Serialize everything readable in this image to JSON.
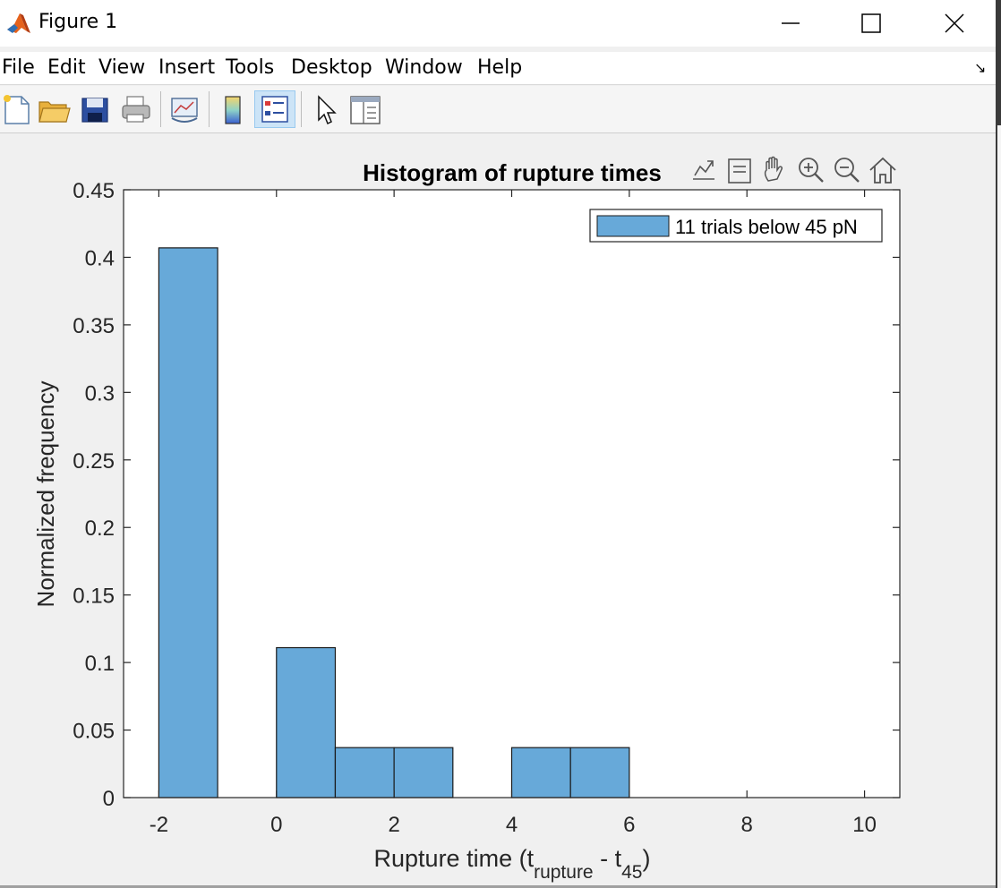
{
  "window": {
    "title": "Figure 1",
    "controls": [
      "minimize",
      "maximize",
      "close"
    ]
  },
  "menu": {
    "items": [
      {
        "label": "File"
      },
      {
        "label": "Edit"
      },
      {
        "label": "View"
      },
      {
        "label": "Insert"
      },
      {
        "label": "Tools"
      },
      {
        "label": "Desktop"
      },
      {
        "label": "Window"
      },
      {
        "label": "Help"
      }
    ]
  },
  "toolbar": {
    "buttons": [
      "new-figure-icon",
      "open-file-icon",
      "save-icon",
      "print-icon",
      "link-plot-icon",
      "colorbar-icon",
      "legend-icon",
      "pointer-icon",
      "property-editor-icon"
    ],
    "pressed": "legend-icon"
  },
  "axes_toolbar": {
    "buttons": [
      "export-icon",
      "brush-icon",
      "pan-icon",
      "zoom-in-icon",
      "zoom-out-icon",
      "home-icon"
    ]
  },
  "colors": {
    "bar_fill": "#67a9d9",
    "bar_edge": "#1a1a1a",
    "axis": "#262626",
    "background": "#ffffff"
  },
  "chart_data": {
    "type": "bar",
    "title": "Histogram of rupture times",
    "xlabel_main": "Rupture time (t",
    "xlabel_sub1": "rupture",
    "xlabel_mid": " - t",
    "xlabel_sub2": "45",
    "xlabel_end": ")",
    "ylabel": "Normalized frequency",
    "xlim": [
      -2.6,
      10.6
    ],
    "ylim": [
      0,
      0.45
    ],
    "xticks": [
      {
        "v": -2,
        "label": "-2"
      },
      {
        "v": 0,
        "label": "0"
      },
      {
        "v": 2,
        "label": "2"
      },
      {
        "v": 4,
        "label": "4"
      },
      {
        "v": 6,
        "label": "6"
      },
      {
        "v": 8,
        "label": "8"
      },
      {
        "v": 10,
        "label": "10"
      }
    ],
    "yticks": [
      {
        "v": 0,
        "label": "0"
      },
      {
        "v": 0.05,
        "label": "0.05"
      },
      {
        "v": 0.1,
        "label": "0.1"
      },
      {
        "v": 0.15,
        "label": "0.15"
      },
      {
        "v": 0.2,
        "label": "0.2"
      },
      {
        "v": 0.25,
        "label": "0.25"
      },
      {
        "v": 0.3,
        "label": "0.3"
      },
      {
        "v": 0.35,
        "label": "0.35"
      },
      {
        "v": 0.4,
        "label": "0.4"
      },
      {
        "v": 0.45,
        "label": "0.45"
      }
    ],
    "bins": [
      {
        "x0": -2,
        "x1": -1,
        "value": 0.407
      },
      {
        "x0": 0,
        "x1": 1,
        "value": 0.111
      },
      {
        "x0": 1,
        "x1": 2,
        "value": 0.037
      },
      {
        "x0": 2,
        "x1": 3,
        "value": 0.037
      },
      {
        "x0": 4,
        "x1": 5,
        "value": 0.037
      },
      {
        "x0": 5,
        "x1": 6,
        "value": 0.037
      }
    ],
    "legend": {
      "label": "11 trials below 45 pN",
      "position": "top-right"
    },
    "grid": false
  }
}
